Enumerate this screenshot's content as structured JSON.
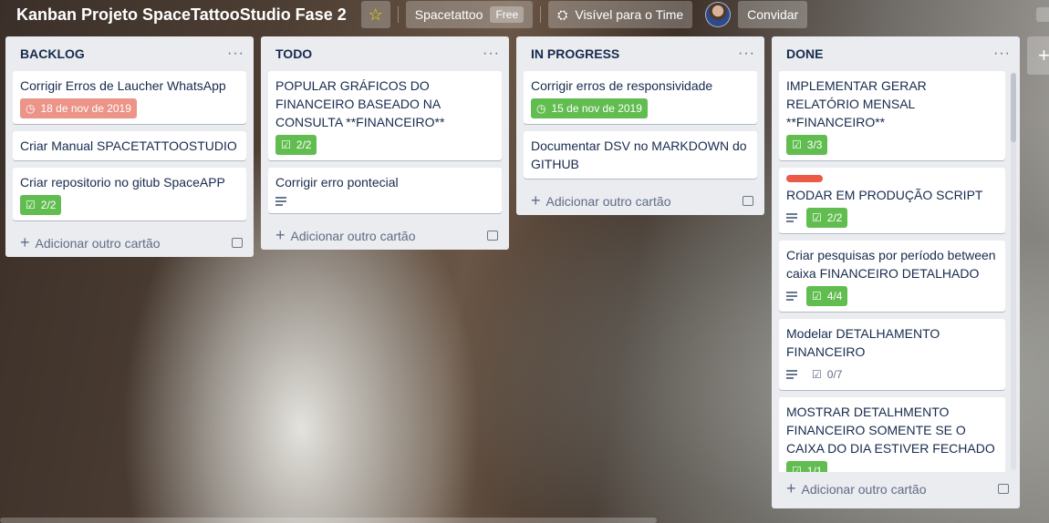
{
  "header": {
    "board_title": "Kanban Projeto SpaceTattooStudio Fase 2",
    "team_name": "Spacetattoo",
    "plan_badge": "Free",
    "visibility": "Visível para o Time",
    "invite": "Convidar"
  },
  "add_card_label": "Adicionar outro cartão",
  "lists": [
    {
      "title": "BACKLOG",
      "cards": [
        {
          "title": "Corrigir Erros de Laucher WhatsApp",
          "due": "18 de nov de 2019"
        },
        {
          "title": "Criar Manual SPACETATTOOSTUDIO"
        },
        {
          "title": "Criar repositorio no gitub SpaceAPP",
          "checklist": "2/2"
        }
      ]
    },
    {
      "title": "TODO",
      "cards": [
        {
          "title": "POPULAR GRÁFICOS DO FINANCEIRO BASEADO NA CONSULTA **FINANCEIRO**",
          "checklist": "2/2"
        },
        {
          "title": "Corrigir erro pontecial"
        }
      ]
    },
    {
      "title": "IN PROGRESS",
      "cards": [
        {
          "title": "Corrigir erros de responsividade",
          "due": "15 de nov de 2019"
        },
        {
          "title": "Documentar DSV no MARKDOWN do GITHUB"
        }
      ]
    },
    {
      "title": "DONE",
      "cards": [
        {
          "title": "IMPLEMENTAR GERAR RELATÓRIO MENSAL **FINANCEIRO**",
          "checklist": "3/3"
        },
        {
          "title": "RODAR EM PRODUÇÃO SCRIPT",
          "checklist": "2/2"
        },
        {
          "title": "Criar pesquisas por período between caixa FINANCEIRO DETALHADO",
          "checklist": "4/4"
        },
        {
          "title": "Modelar DETALHAMENTO FINANCEIRO",
          "checklist": "0/7"
        },
        {
          "title": "MOSTRAR DETALHMENTO FINANCEIRO SOMENTE SE O CAIXA DO DIA ESTIVER FECHADO",
          "checklist": "1/1"
        }
      ]
    }
  ],
  "colors": {
    "complete_green": "#61bd4f",
    "overdue_red": "#ec9488",
    "label_red": "#eb5a46",
    "list_bg": "#ebecf0"
  }
}
